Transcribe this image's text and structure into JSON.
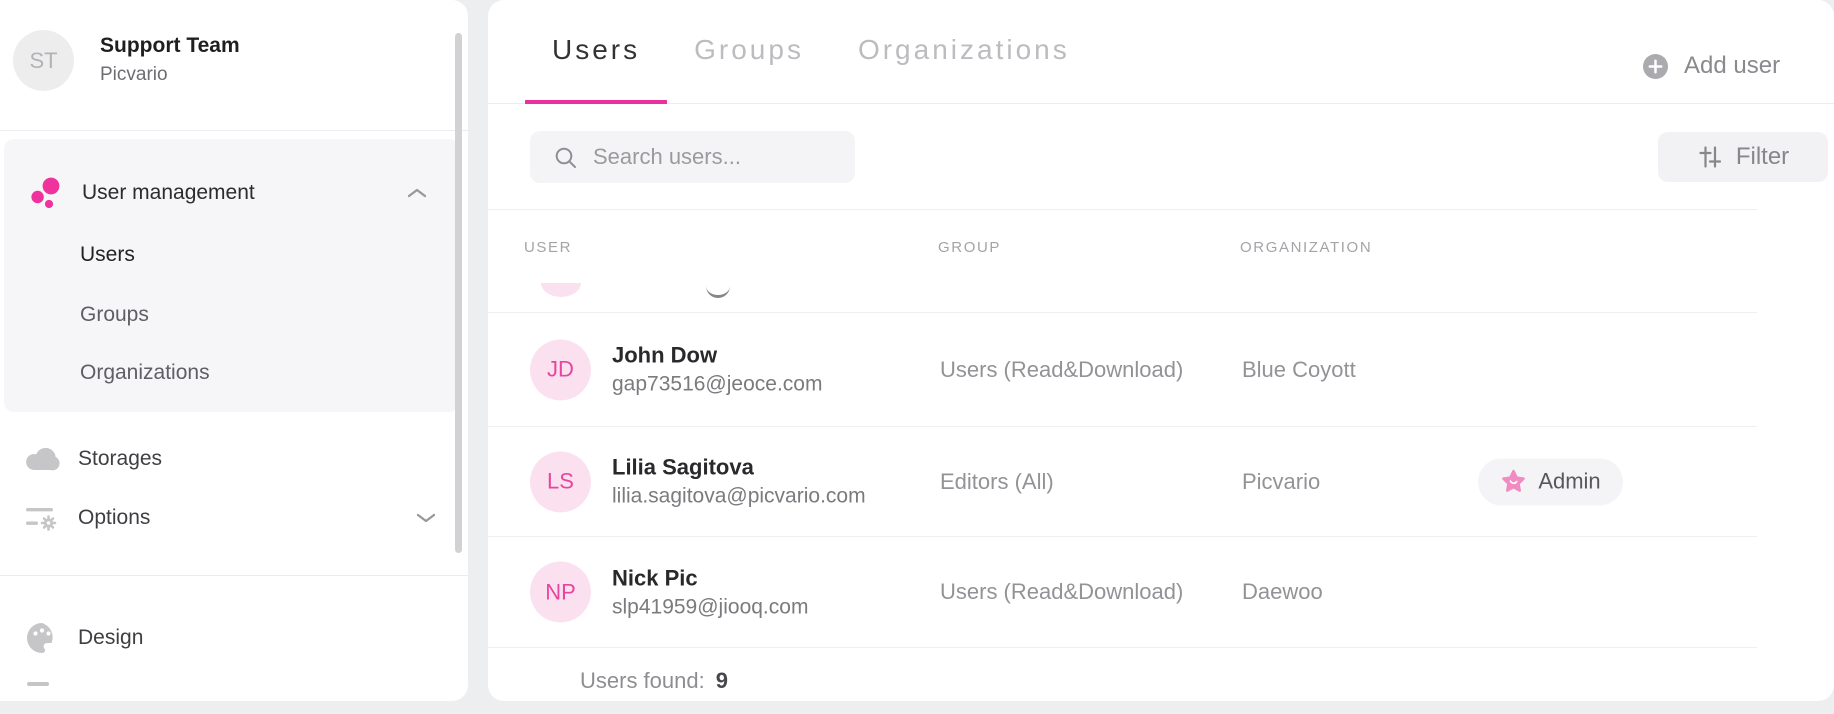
{
  "sidebar": {
    "account": {
      "initials": "ST",
      "name": "Support Team",
      "subtitle": "Picvario"
    },
    "user_management": {
      "label": "User management",
      "items": [
        {
          "label": "Users",
          "active": true
        },
        {
          "label": "Groups",
          "active": false
        },
        {
          "label": "Organizations",
          "active": false
        }
      ]
    },
    "items": [
      {
        "label": "Storages"
      },
      {
        "label": "Options"
      },
      {
        "label": "Design"
      }
    ]
  },
  "main": {
    "tabs": [
      {
        "label": "Users",
        "active": true
      },
      {
        "label": "Groups",
        "active": false
      },
      {
        "label": "Organizations",
        "active": false
      }
    ],
    "add_user_label": "Add user",
    "search": {
      "placeholder": "Search users...",
      "value": ""
    },
    "filter_label": "Filter",
    "table": {
      "columns": [
        "USER",
        "GROUP",
        "ORGANIZATION"
      ],
      "rows": [
        {
          "initials": "JD",
          "name": "John Dow",
          "email": "gap73516@jeoce.com",
          "group": "Users (Read&Download)",
          "organization": "Blue Coyott",
          "badge": null
        },
        {
          "initials": "LS",
          "name": "Lilia Sagitova",
          "email": "lilia.sagitova@picvario.com",
          "group": "Editors (All)",
          "organization": "Picvario",
          "badge": "Admin"
        },
        {
          "initials": "NP",
          "name": "Nick Pic",
          "email": "slp41959@jiooq.com",
          "group": "Users (Read&Download)",
          "organization": "Daewoo",
          "badge": null
        }
      ]
    },
    "footer": {
      "label": "Users found:",
      "count": "9"
    }
  },
  "colors": {
    "accent_pink": "#e8319c",
    "avatar_bg": "#fbe1f0",
    "avatar_text": "#e8459f",
    "badge_star": "#f08cc2"
  }
}
